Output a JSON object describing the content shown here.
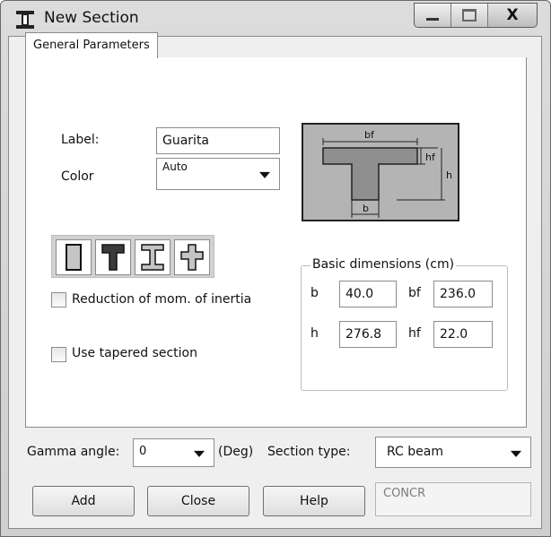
{
  "window": {
    "title": "New Section",
    "app_icon": "i-beam-icon",
    "controls": {
      "minimize": "minimize-icon",
      "maximize": "maximize-icon",
      "close": "X"
    }
  },
  "tabs": [
    {
      "label": "General Parameters",
      "selected": true
    }
  ],
  "general": {
    "label_caption": "Label:",
    "label_value": "Guarita",
    "color_caption": "Color",
    "color_value": "Auto"
  },
  "preview_labels": {
    "bf": "bf",
    "hf": "hf",
    "h": "h",
    "b": "b"
  },
  "shape_buttons": [
    {
      "name": "rectangle-section-icon"
    },
    {
      "name": "t-section-icon",
      "selected": true
    },
    {
      "name": "i-section-icon"
    },
    {
      "name": "cross-section-icon"
    }
  ],
  "options": {
    "reduction_label": "Reduction of mom. of inertia",
    "reduction_checked": false,
    "tapered_label": "Use tapered section",
    "tapered_checked": false
  },
  "dimensions": {
    "title": "Basic dimensions (cm)",
    "b_label": "b",
    "b_value": "40.0",
    "bf_label": "bf",
    "bf_value": "236.0",
    "h_label": "h",
    "h_value": "276.8",
    "hf_label": "hf",
    "hf_value": "22.0"
  },
  "footer": {
    "gamma_label": "Gamma angle:",
    "gamma_value": "0",
    "gamma_unit": "(Deg)",
    "section_type_label": "Section type:",
    "section_type_value": "RC beam",
    "material_value": "CONCR"
  },
  "buttons": {
    "add": "Add",
    "close": "Close",
    "help": "Help"
  }
}
